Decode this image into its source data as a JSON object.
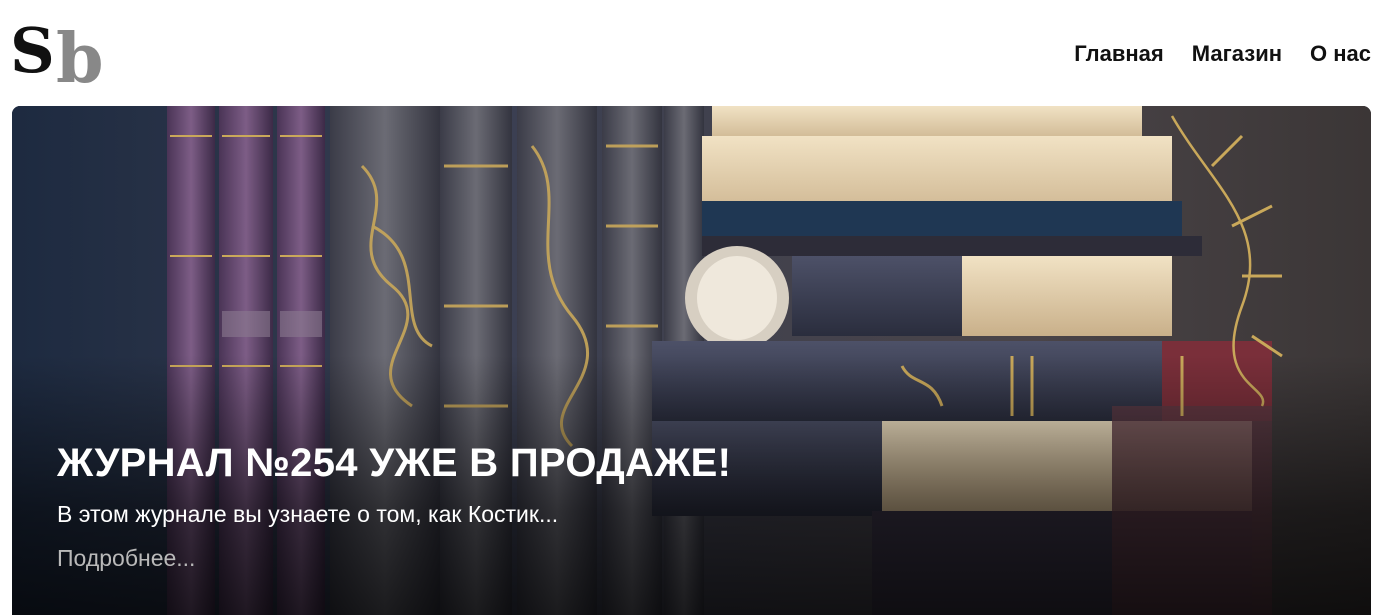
{
  "brand": {
    "logo_text": "Sb",
    "logo_colors": {
      "s": "#111111",
      "b": "#888888"
    }
  },
  "nav": {
    "items": [
      {
        "label": "Главная"
      },
      {
        "label": "Магазин"
      },
      {
        "label": "О нас"
      }
    ]
  },
  "hero": {
    "title": "ЖУРНАЛ №254 УЖЕ В ПРОДАЖЕ!",
    "subtitle": "В этом журнале вы узнаете о том, как Костик...",
    "more_link": "Подробнее...",
    "image_icon": "books-illustration"
  },
  "colors": {
    "text_dark": "#111111",
    "hero_text": "#ffffff",
    "more_link": "#b9b9b9"
  }
}
